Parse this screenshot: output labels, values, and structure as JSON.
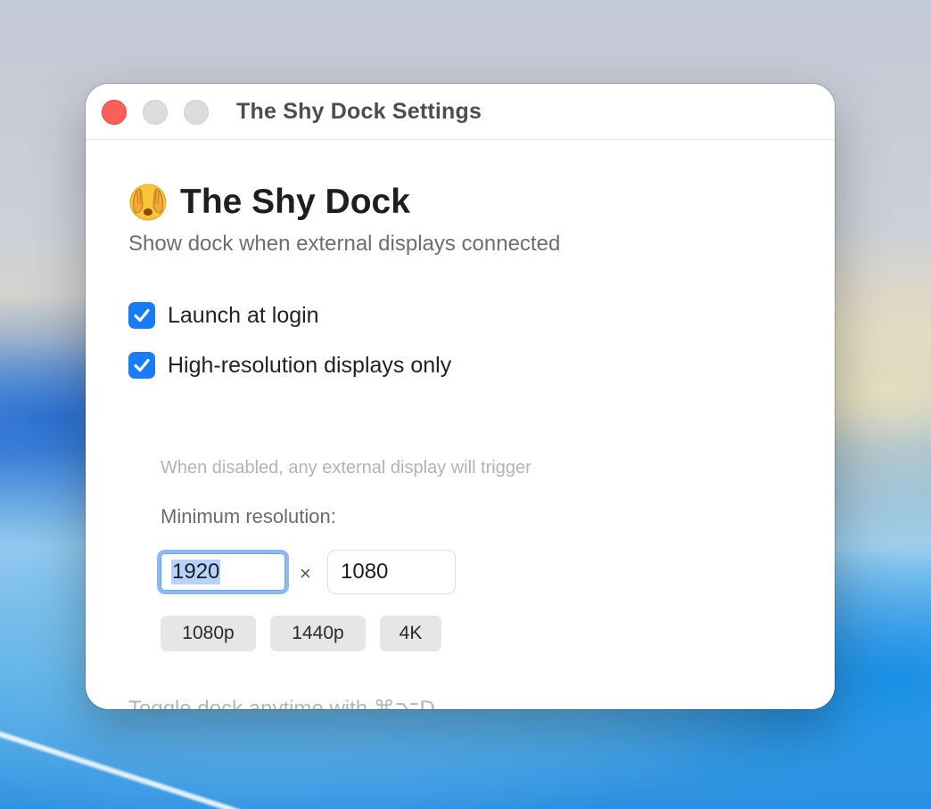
{
  "window": {
    "title": "The Shy Dock Settings"
  },
  "app": {
    "emoji_icon": "face-with-hands-over-eyes",
    "name": "The Shy Dock",
    "subtitle": "Show dock when external displays connected"
  },
  "options": {
    "launch_at_login": {
      "label": "Launch at login",
      "checked": true
    },
    "high_res_only": {
      "label": "High-resolution displays only",
      "checked": true
    },
    "high_res_hint": "When disabled, any external display will trigger"
  },
  "resolution": {
    "label": "Minimum resolution:",
    "width_value": "1920",
    "separator": "×",
    "height_value": "1080",
    "presets": [
      "1080p",
      "1440p",
      "4K"
    ]
  },
  "footer": {
    "hint": "Toggle dock anytime with ⌘⌥D"
  },
  "colors": {
    "accent": "#1a7cf5",
    "close_button": "#fe5f57",
    "focus_ring": "#8db9f3"
  }
}
